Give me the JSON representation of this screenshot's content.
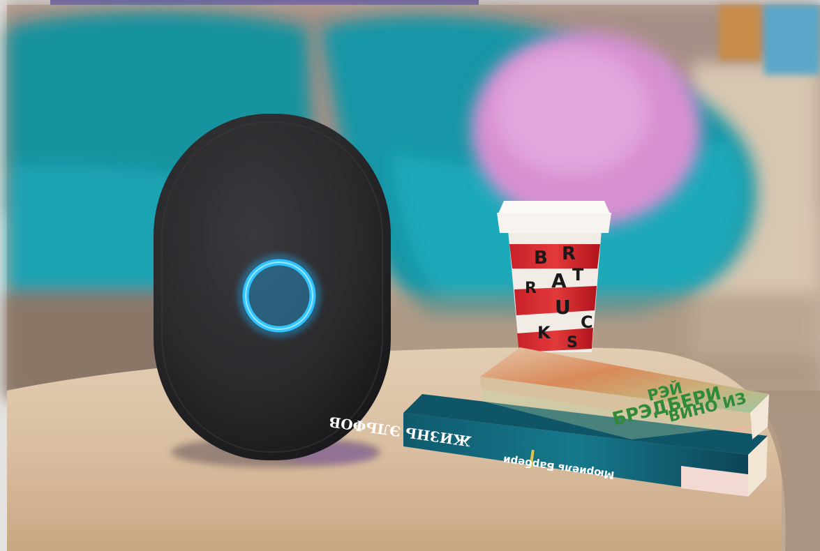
{
  "scene": {
    "colors": {
      "background_wall": "#c9b7a6",
      "chair": "#1aa3b3",
      "cushion": "#d98fd3",
      "table_top": "#d8bea1",
      "speaker": "#2b2b2e",
      "speaker_ring": "#2fc4ff",
      "frame_accent": "#5f55a7"
    },
    "cup_letters": [
      "B",
      "R",
      "T",
      "A",
      "R",
      "U",
      "C",
      "K",
      "S"
    ],
    "book_top": {
      "author": "РЭЙ",
      "title_line_1": "БРЭДБЕРИ",
      "title_line_2": "ВИНО ИЗ"
    },
    "book_bottom": {
      "title": "ЖИЗНЬ ЭЛЬФОВ",
      "author": "Мюриель Барбери"
    }
  }
}
